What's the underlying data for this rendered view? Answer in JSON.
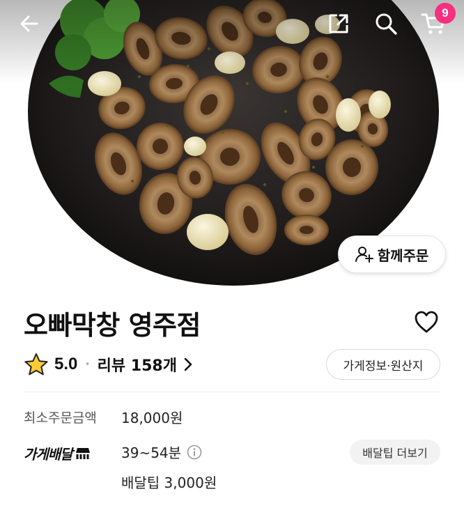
{
  "header": {
    "back_icon": "arrow-left-icon",
    "share_icon": "share-icon",
    "search_icon": "search-icon",
    "cart_icon": "cart-icon",
    "cart_count": "9",
    "badge_color": "#f5307e"
  },
  "hero": {
    "together_order_icon": "person-add-icon",
    "together_order_label": "함께주문"
  },
  "store": {
    "name": "오빠막창 영주점",
    "favorite_icon": "heart-outline-icon",
    "rating": "5.0",
    "review_label": "리뷰 158개",
    "info_button": "가게정보·원산지"
  },
  "order_info": {
    "min_order_label": "최소주문금액",
    "min_order_value": "18,000원",
    "delivery_type": "가게배달",
    "delivery_time": "39~54분",
    "delivery_tip": "배달팁 3,000원",
    "tip_more_button": "배달팁 더보기"
  }
}
